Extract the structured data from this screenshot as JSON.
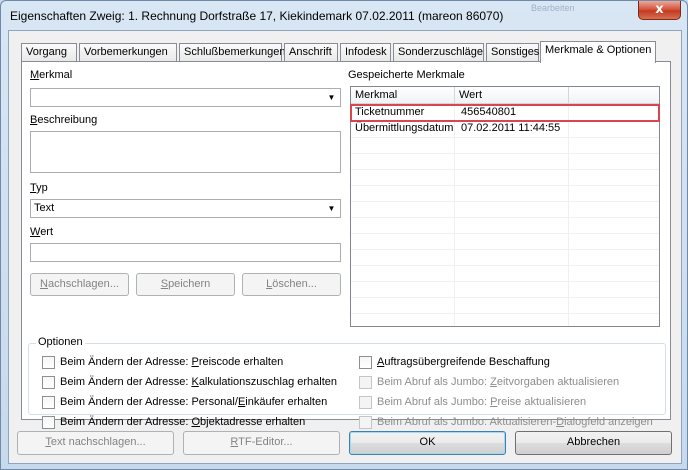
{
  "window": {
    "title": "Eigenschaften Zweig: 1. Rechnung Dorfstraße 17, Kiekindemark 07.02.2011 (mareon 86070)",
    "ghost_text": "Bearbeiten",
    "close_label": "x"
  },
  "tabs": [
    {
      "label": "Vorgang"
    },
    {
      "label": "Vorbemerkungen"
    },
    {
      "label": "Schlußbemerkungen"
    },
    {
      "label": "Anschrift"
    },
    {
      "label": "Infodesk"
    },
    {
      "label": "Sonderzuschläge"
    },
    {
      "label": "Sonstiges"
    },
    {
      "label": "Merkmale & Optionen",
      "active": true
    }
  ],
  "form": {
    "merkmal": {
      "label_u": "M",
      "label_rest": "erkmal",
      "value": ""
    },
    "beschreibung": {
      "label_u": "B",
      "label_rest": "eschreibung",
      "value": ""
    },
    "typ": {
      "label_u": "T",
      "label_rest": "yp",
      "value": "Text"
    },
    "wert": {
      "label_u": "W",
      "label_rest": "ert",
      "value": ""
    }
  },
  "buttons": {
    "nachschlagen": {
      "u": "N",
      "rest": "achschlagen..."
    },
    "speichern": {
      "u": "S",
      "rest": "peichern"
    },
    "loeschen": {
      "u": "L",
      "rest": "öschen..."
    }
  },
  "saved": {
    "title": "Gespeicherte Merkmale",
    "columns": [
      "Merkmal",
      "Wert"
    ],
    "rows": [
      {
        "merkmal": "Ticketnummer",
        "wert": "456540801"
      },
      {
        "merkmal": "Übermittlungsdatum",
        "wert": "07.02.2011 11:44:55"
      }
    ]
  },
  "options": {
    "title": "Optionen",
    "left": [
      {
        "pre": "Beim Ändern der Adresse: ",
        "u": "P",
        "post": "reiscode erhalten"
      },
      {
        "pre": "Beim Ändern der Adresse: ",
        "u": "K",
        "post": "alkulationszuschlag erhalten"
      },
      {
        "pre": "Beim Ändern der Adresse: Personal/",
        "u": "E",
        "post": "inkäufer erhalten"
      },
      {
        "pre": "Beim Ändern der Adresse: ",
        "u": "O",
        "post": "bjektadresse erhalten"
      }
    ],
    "right": [
      {
        "pre": "",
        "u": "A",
        "post": "uftragsübergreifende Beschaffung"
      },
      {
        "pre": "Beim Abruf als Jumbo: ",
        "u": "Z",
        "post": "eitvorgaben aktualisieren"
      },
      {
        "pre": "Beim Abruf als Jumbo: ",
        "u": "P",
        "post": "reise aktualisieren"
      },
      {
        "pre": "Beim Abruf als Jumbo: Aktualisieren-",
        "u": "D",
        "post": "ialogfeld anzeigen"
      }
    ]
  },
  "footer": {
    "text_nachschlagen": {
      "u": "T",
      "rest": "ext nachschlagen..."
    },
    "rtf_editor": {
      "u": "R",
      "rest": "TF-Editor..."
    },
    "ok": "OK",
    "abbrechen": "Abbrechen"
  }
}
